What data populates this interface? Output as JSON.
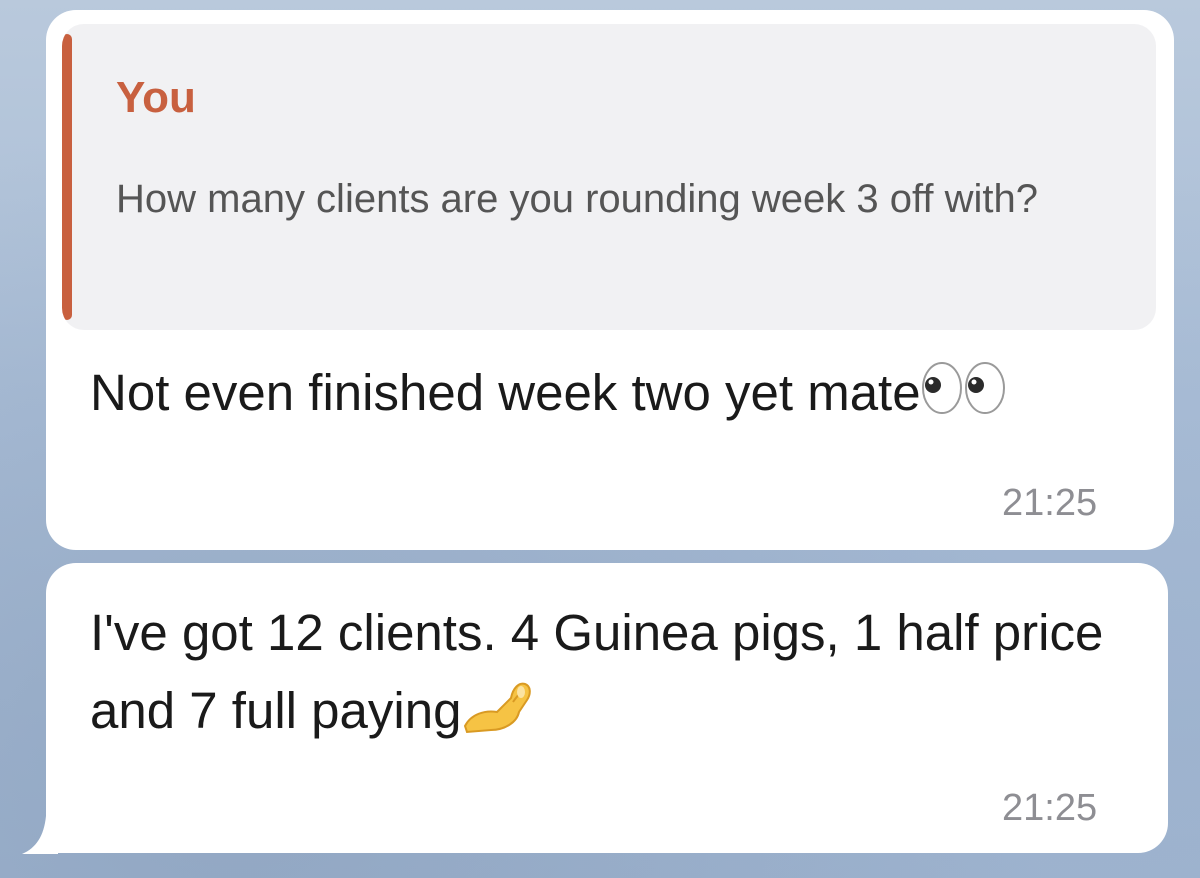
{
  "messages": [
    {
      "reply": {
        "author": "You",
        "text": "How many clients are you rounding week 3 off with?",
        "accent_color": "#c8603f"
      },
      "text": "Not even finished week two yet mate",
      "emoji": "eyes-icon",
      "time": "21:25"
    },
    {
      "text": "I've got 12 clients. 4 Guinea pigs, 1 half price and 7 full paying",
      "emoji": "pinching-hand-icon",
      "time": "21:25"
    }
  ],
  "colors": {
    "bubble": "#ffffff",
    "quote_background": "#f1f1f3",
    "time": "#8e8e93",
    "wallpaper": "#a9bdd6"
  }
}
